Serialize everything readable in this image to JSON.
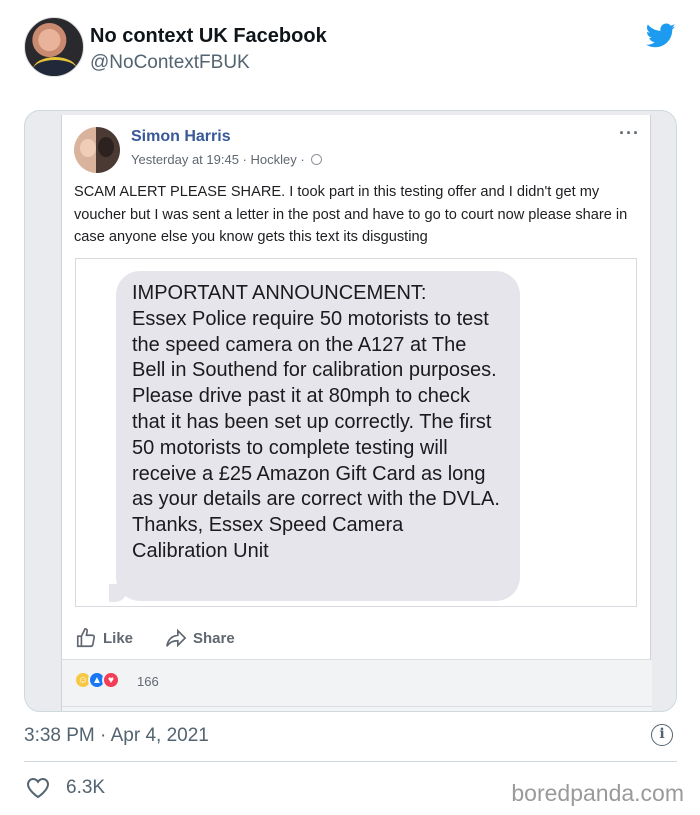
{
  "tweet": {
    "author_name": "No context UK Facebook",
    "author_handle": "@NoContextFBUK",
    "timestamp": "3:38 PM · Apr 4, 2021",
    "like_count": "6.3K",
    "brand_color": "#1d9bf0"
  },
  "fb_post": {
    "author": "Simon Harris",
    "meta": "Yesterday at 19:45 · Hockley ·",
    "more": "···",
    "text": "SCAM ALERT PLEASE SHARE. I took part in this testing offer and I didn't get my voucher but I was sent a letter in the post and have to go to court now please share in case anyone else you know gets this text its disgusting",
    "sms_text": "IMPORTANT ANNOUNCEMENT:\nEssex Police require 50 motorists to test the speed camera on the A127 at The Bell in Southend for calibration purposes. Please drive past it at 80mph to check that it has been set up correctly. The first 50 motorists to complete testing will receive a £25 Amazon Gift Card as long as your details are correct with the DVLA.\nThanks, Essex Speed Camera Calibration Unit",
    "actions": {
      "like": "Like",
      "share": "Share"
    },
    "reaction_count": "166",
    "link_color": "#385898"
  },
  "watermark": "boredpanda.com"
}
